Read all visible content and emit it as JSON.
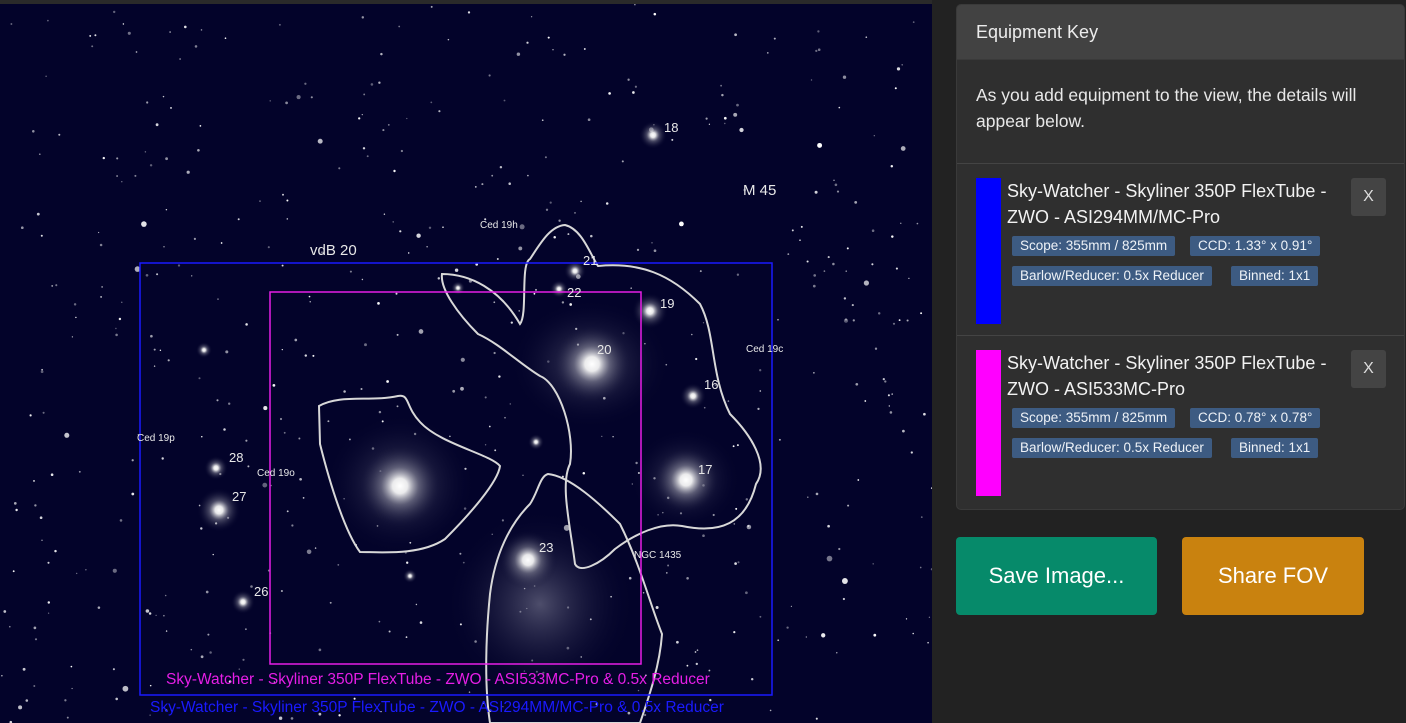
{
  "sky": {
    "labels": {
      "vdb20": "vdB 20",
      "m45": "M 45",
      "ced19h": "Ced 19h",
      "ced19c": "Ced 19c",
      "ced19p": "Ced 19p",
      "ced19o": "Ced 19o",
      "ngc1435": "NGC 1435",
      "n18": "18",
      "n19": "19",
      "n20": "20",
      "n21": "21",
      "n22": "22",
      "n23": "23",
      "n16": "16",
      "n17": "17",
      "n26": "26",
      "n27": "27",
      "n28": "28"
    },
    "fov_labels": {
      "magenta": "Sky-Watcher - Skyliner 350P FlexTube - ZWO - ASI533MC-Pro  & 0.5x Reducer",
      "blue": "Sky-Watcher - Skyliner 350P FlexTube - ZWO - ASI294MM/MC-Pro  & 0.5x Reducer"
    },
    "colors": {
      "magenta": "#e61ee6",
      "blue": "#1a1aff"
    }
  },
  "panel": {
    "title": "Equipment Key",
    "intro": "As you add equipment to the view, the details will appear below.",
    "items": [
      {
        "color": "#0000ff",
        "title": "Sky-Watcher - Skyliner 350P FlexTube - ZWO - ASI294MM/MC-Pro",
        "scope": "Scope: 355mm / 825mm",
        "ccd": "CCD: 1.33° x 0.91°",
        "barlow": "Barlow/Reducer: 0.5x Reducer",
        "binned": "Binned: 1x1",
        "remove": "X"
      },
      {
        "color": "#ff00ff",
        "title": "Sky-Watcher - Skyliner 350P FlexTube - ZWO - ASI533MC-Pro",
        "scope": "Scope: 355mm / 825mm",
        "ccd": "CCD: 0.78° x 0.78°",
        "barlow": "Barlow/Reducer: 0.5x Reducer",
        "binned": "Binned: 1x1",
        "remove": "X"
      }
    ]
  },
  "buttons": {
    "save": "Save Image...",
    "share": "Share FOV"
  }
}
